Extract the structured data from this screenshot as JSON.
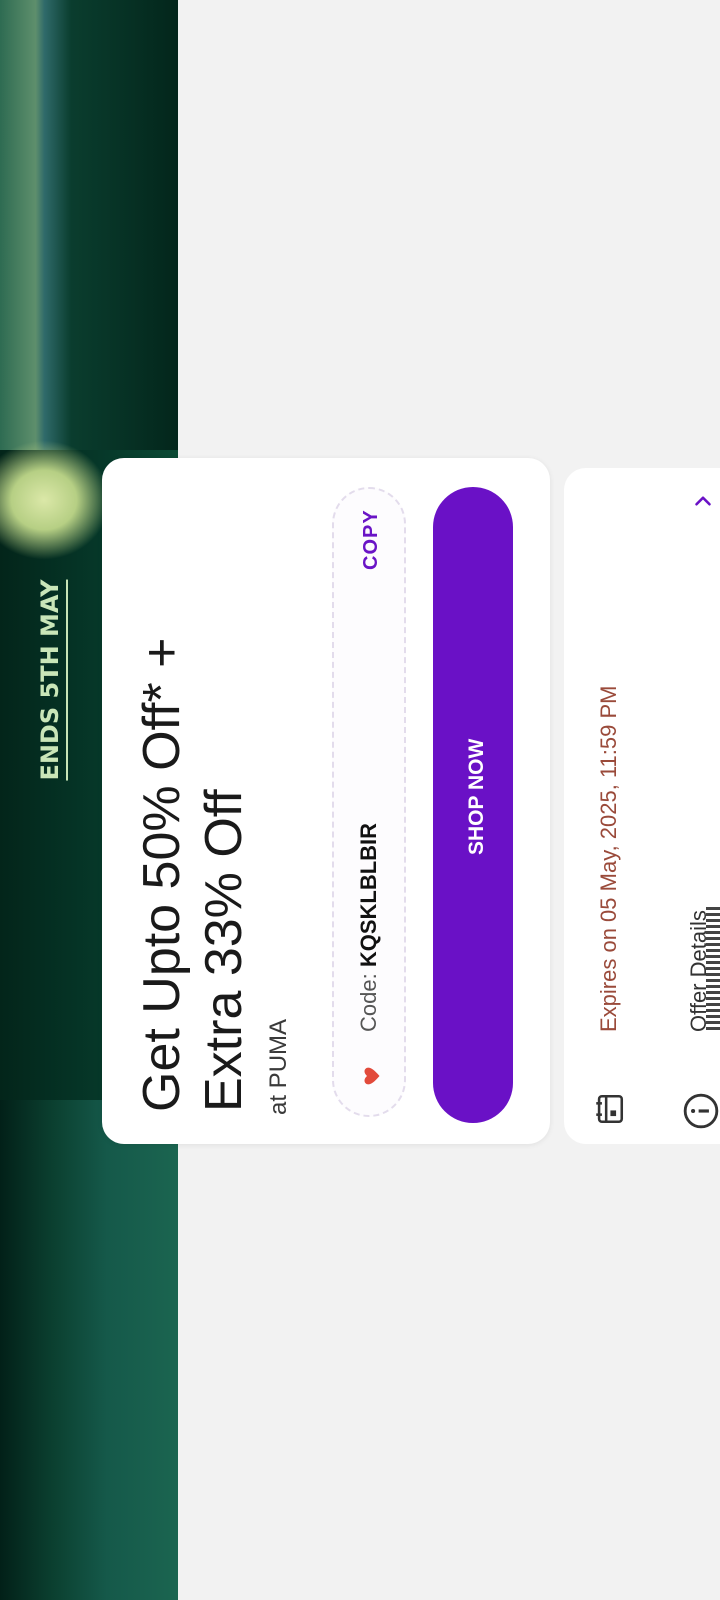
{
  "banner": {
    "ends_text": "ENDS 5TH MAY"
  },
  "offer": {
    "title_line1": "Get Upto 50% Off* +",
    "title_line2": "Extra 33% Off",
    "merchant": "at PUMA",
    "code_label": "Code:",
    "code": "KQSKLBLBIR",
    "copy_label": "COPY",
    "cta_label": "SHOP NOW"
  },
  "info": {
    "expiry": "Expires on 05 May, 2025, 11:59 PM",
    "offer_details_label": "Offer Details"
  },
  "colors": {
    "accent": "#6a11c6",
    "expiry_text": "#9a4a3a",
    "heart": "#e24a3b",
    "banner_green": "#06392a"
  },
  "icons": [
    "heart-icon",
    "calendar-icon",
    "info-icon",
    "chevron-right-icon"
  ]
}
